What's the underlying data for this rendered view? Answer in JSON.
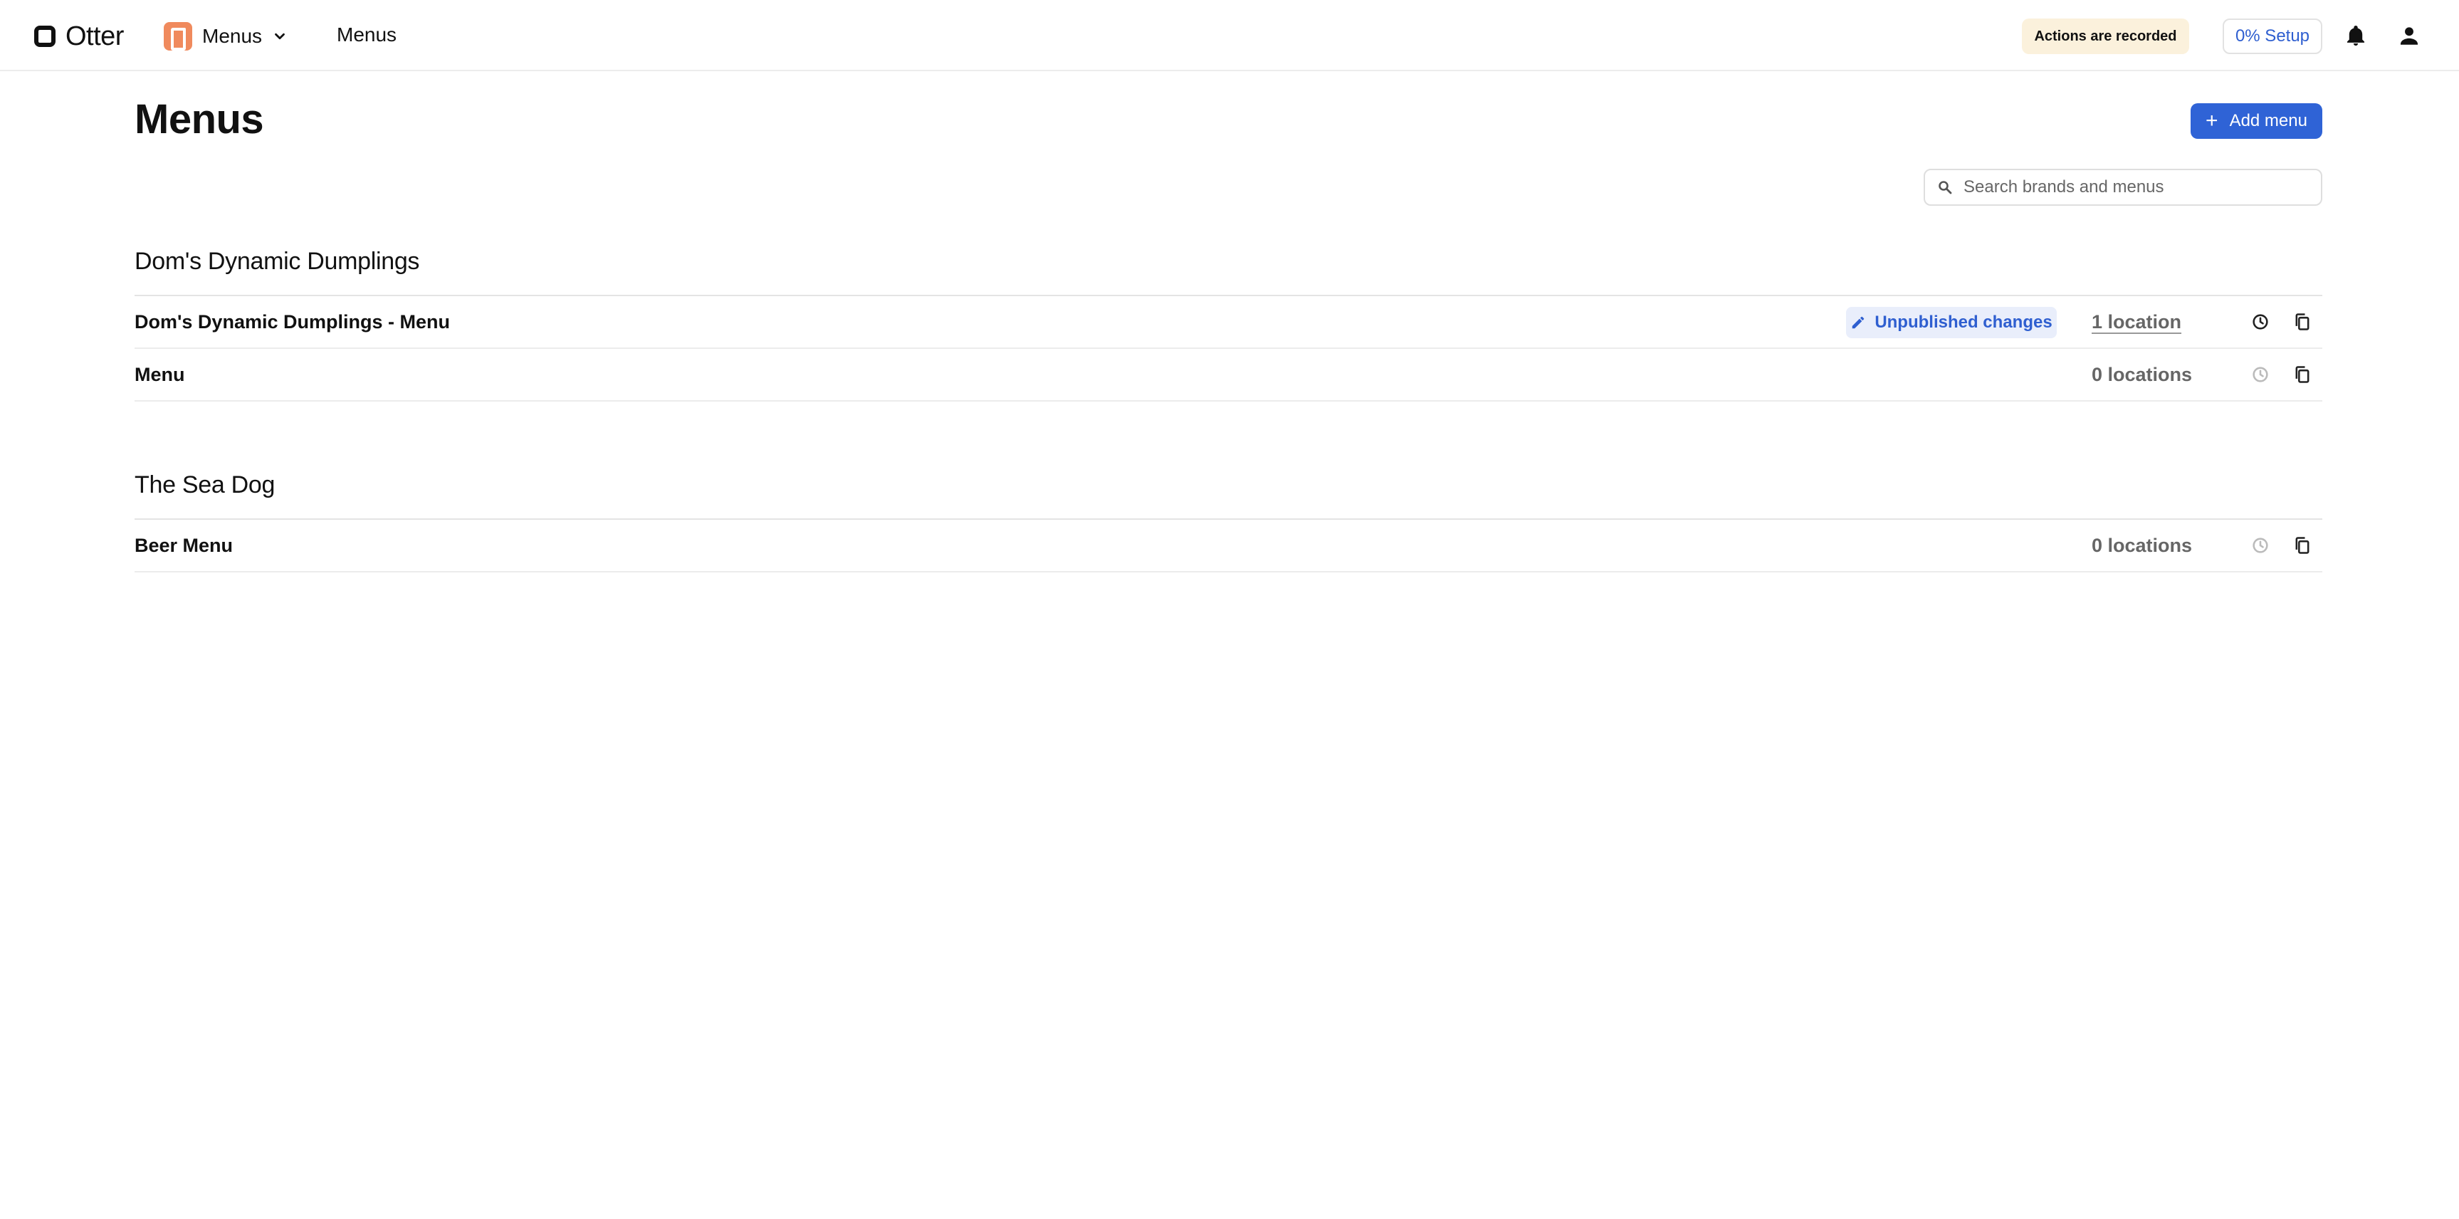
{
  "header": {
    "logo_text": "Otter",
    "app_name": "Menus",
    "breadcrumb": "Menus",
    "recorded_badge": "Actions are recorded",
    "setup_label": "0% Setup"
  },
  "page": {
    "title": "Menus",
    "add_button_label": "Add menu",
    "search_placeholder": "Search brands and menus",
    "search_value": ""
  },
  "brands": [
    {
      "name": "Dom's Dynamic Dumplings",
      "menus": [
        {
          "name": "Dom's Dynamic Dumplings - Menu",
          "badge": "Unpublished changes",
          "locations": "1 location"
        },
        {
          "name": "Menu",
          "badge": "",
          "locations": "0 locations"
        }
      ]
    },
    {
      "name": "The Sea Dog",
      "menus": [
        {
          "name": "Beer Menu",
          "badge": "",
          "locations": "0 locations"
        }
      ]
    }
  ],
  "icons": {
    "logo": "otter-logo-icon",
    "app": "menus-app-icon",
    "chevron": "chevron-down-icon",
    "bell": "bell-icon",
    "user": "user-icon",
    "plus": "plus-icon",
    "search": "search-icon",
    "pencil": "pencil-icon",
    "history": "history-icon",
    "copy": "copy-icon"
  },
  "colors": {
    "accent": "#2f63d6",
    "badge_bg": "#e9eefb",
    "recorded_bg": "#fbf1dc",
    "app_icon": "#f08a5d"
  }
}
